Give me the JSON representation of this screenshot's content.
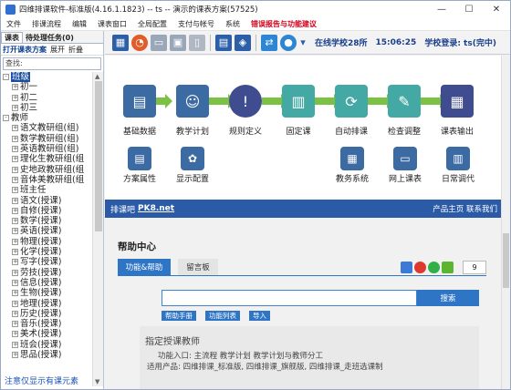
{
  "window": {
    "title": "四维排课软件-标准版(4.16.1.1823) -- ts -- 演示的课表方案(57525)",
    "min": "—",
    "max": "☐",
    "close": "✕"
  },
  "menu": [
    "文件",
    "排课流程",
    "编辑",
    "课表窗口",
    "全局配置",
    "支付与帐号",
    "系统",
    "错误报告与功能建议"
  ],
  "left": {
    "tabs": [
      "课表",
      "待处理任务(0)"
    ],
    "buttons": [
      "打开课表方案",
      "展开",
      "折叠"
    ],
    "search_placeholder": "查找:",
    "tree": [
      {
        "label": "班级",
        "level": 0,
        "sign": "-",
        "selected": true
      },
      {
        "label": "初一",
        "level": 1,
        "sign": "+"
      },
      {
        "label": "初二",
        "level": 1,
        "sign": "+"
      },
      {
        "label": "初三",
        "level": 1,
        "sign": "+"
      },
      {
        "label": "教师",
        "level": 0,
        "sign": "-"
      },
      {
        "label": "语文教研组(组)",
        "level": 1,
        "sign": "+"
      },
      {
        "label": "数学教研组(组)",
        "level": 1,
        "sign": "+"
      },
      {
        "label": "英语教研组(组)",
        "level": 1,
        "sign": "+"
      },
      {
        "label": "理化生教研组(组",
        "level": 1,
        "sign": "+"
      },
      {
        "label": "史地政教研组(组",
        "level": 1,
        "sign": "+"
      },
      {
        "label": "音体美教研组(组",
        "level": 1,
        "sign": "+"
      },
      {
        "label": "班主任",
        "level": 1,
        "sign": "+"
      },
      {
        "label": "语文(授课)",
        "level": 1,
        "sign": "+"
      },
      {
        "label": "自修(授课)",
        "level": 1,
        "sign": "+"
      },
      {
        "label": "数学(授课)",
        "level": 1,
        "sign": "+"
      },
      {
        "label": "英语(授课)",
        "level": 1,
        "sign": "+"
      },
      {
        "label": "物理(授课)",
        "level": 1,
        "sign": "+"
      },
      {
        "label": "化学(授课)",
        "level": 1,
        "sign": "+"
      },
      {
        "label": "写字(授课)",
        "level": 1,
        "sign": "+"
      },
      {
        "label": "劳技(授课)",
        "level": 1,
        "sign": "+"
      },
      {
        "label": "信息(授课)",
        "level": 1,
        "sign": "+"
      },
      {
        "label": "生物(授课)",
        "level": 1,
        "sign": "+"
      },
      {
        "label": "地理(授课)",
        "level": 1,
        "sign": "+"
      },
      {
        "label": "历史(授课)",
        "level": 1,
        "sign": "+"
      },
      {
        "label": "音乐(授课)",
        "level": 1,
        "sign": "+"
      },
      {
        "label": "美术(授课)",
        "level": 1,
        "sign": "+"
      },
      {
        "label": "班会(授课)",
        "level": 1,
        "sign": "+"
      },
      {
        "label": "思品(授课)",
        "level": 1,
        "sign": "+"
      }
    ],
    "footer": "注意仅显示有课元素"
  },
  "toolbar": {
    "online": "在线学校28所",
    "time": "15:06:25",
    "login": "学校登录: ts(完中)"
  },
  "flow": {
    "steps": [
      "基础数据",
      "教学计划",
      "规则定义",
      "固定课",
      "自动排课",
      "检查调整",
      "课表输出"
    ],
    "extras": [
      "方案属性",
      "显示配置",
      "教务系统",
      "网上课表",
      "日常调代"
    ]
  },
  "banner": {
    "prefix": "排课吧",
    "link": "PK8.net",
    "right": "产品主页 联系我们"
  },
  "help": {
    "title": "帮助中心",
    "tab_active": "功能&帮助",
    "tab_other": "留言板",
    "count": "9",
    "search_button": "搜索",
    "quick": [
      "帮助手册",
      "功能列表",
      "导入"
    ],
    "card_title": "指定授课教师",
    "card_line1": "功能入口: 主流程 教学计划 教学计划与教师分工",
    "card_line2": "适用产品: 四维排课_标准版, 四维排课_旗舰版, 四维排课_走班选课制"
  }
}
